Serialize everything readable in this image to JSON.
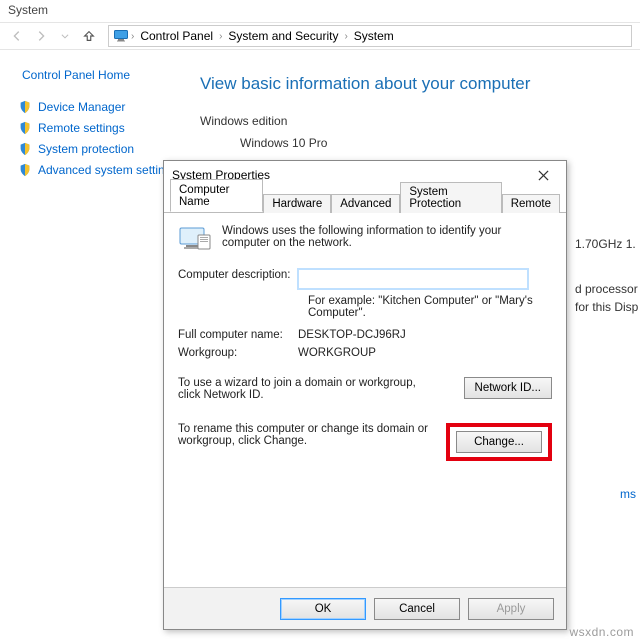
{
  "sys": {
    "title": "System",
    "crumbs": [
      "Control Panel",
      "System and Security",
      "System"
    ],
    "side": {
      "home": "Control Panel Home",
      "links": [
        "Device Manager",
        "Remote settings",
        "System protection",
        "Advanced system settings"
      ]
    },
    "heading": "View basic information about your computer",
    "edition_label": "Windows edition",
    "edition_value": "Windows 10 Pro",
    "right_frags": {
      "cpu": "1.70GHz  1.",
      "proc": "d processor",
      "disp": "for this Disp",
      "ms": "ms"
    }
  },
  "dlg": {
    "title": "System Properties",
    "tabs": [
      "Computer Name",
      "Hardware",
      "Advanced",
      "System Protection",
      "Remote"
    ],
    "intro": "Windows uses the following information to identify your computer on the network.",
    "desc_label": "Computer description:",
    "desc_value": "",
    "example": "For example: \"Kitchen Computer\" or \"Mary's Computer\".",
    "fullname_label": "Full computer name:",
    "fullname_value": "DESKTOP-DCJ96RJ",
    "workgroup_label": "Workgroup:",
    "workgroup_value": "WORKGROUP",
    "wizard_hint": "To use a wizard to join a domain or workgroup, click Network ID.",
    "netid_btn": "Network ID...",
    "rename_hint": "To rename this computer or change its domain or workgroup, click Change.",
    "change_btn": "Change...",
    "ok": "OK",
    "cancel": "Cancel",
    "apply": "Apply"
  },
  "watermark": "wsxdn.com"
}
